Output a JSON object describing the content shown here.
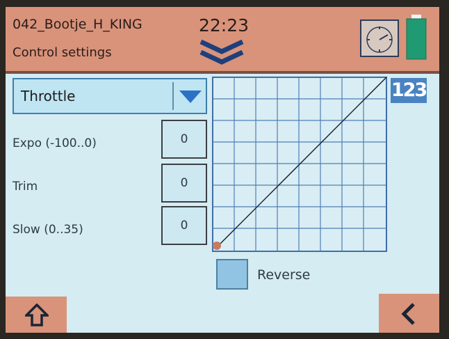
{
  "header": {
    "model_name": "042_Bootje_H_KING",
    "screen_title": "Control settings",
    "time": "22:23",
    "icons": {
      "menu": "double-chevron-down-icon",
      "timer": "timer-icon",
      "battery": "battery-icon"
    }
  },
  "control": {
    "selected_channel": "Throttle",
    "params": [
      {
        "label": "Expo (-100..0)",
        "value": "0"
      },
      {
        "label": "Trim",
        "value": "0"
      },
      {
        "label": "Slow (0..35)",
        "value": "0"
      }
    ],
    "reverse": {
      "label": "Reverse",
      "checked": false
    }
  },
  "mode_indicator": "123",
  "footer": {
    "home_icon": "home-icon",
    "back_icon": "chevron-left-icon"
  },
  "colors": {
    "header": "#d9937a",
    "panel": "#d4ecf2",
    "accent": "#4a83c1",
    "grid": "#3f6ea8"
  }
}
